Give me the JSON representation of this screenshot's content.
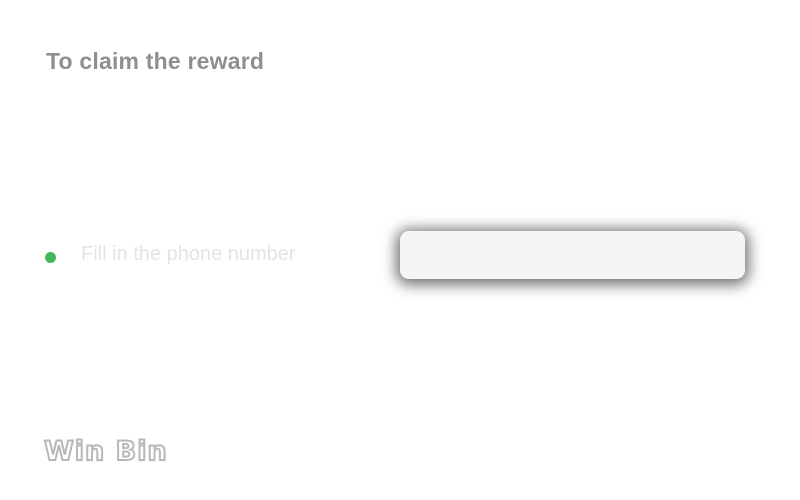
{
  "header": {
    "title": "To claim the reward"
  },
  "step": {
    "label": "Fill in the phone number",
    "indicator_color": "#43b75a"
  },
  "phone_input": {
    "value": "",
    "placeholder": ""
  },
  "brand": {
    "logo_text": "Win Bin"
  }
}
